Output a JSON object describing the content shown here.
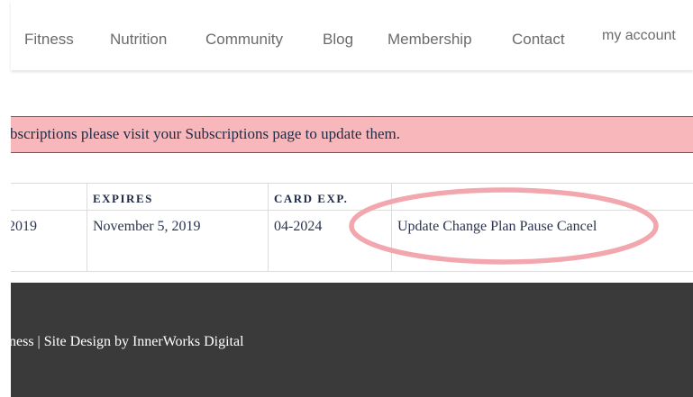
{
  "nav": {
    "items": [
      "Fitness",
      "Nutrition",
      "Community",
      "Blog",
      "Membership",
      "Contact"
    ],
    "account_label": "my account"
  },
  "notice": {
    "text": "bscriptions please visit your Subscriptions page to update them.",
    "background_color": "#f8b7bb",
    "border_color": "#c8323c"
  },
  "table": {
    "headers": [
      "EXPIRES",
      "CARD EXP."
    ],
    "row": {
      "start": "2019",
      "expires": "November 5, 2019",
      "card_exp": "04-2024",
      "actions": [
        "Update",
        "Change Plan",
        "Pause",
        "Cancel"
      ]
    }
  },
  "highlight": {
    "color": "#f2a6ad"
  },
  "footer": {
    "text": "ness | Site Design by InnerWorks Digital",
    "background_color": "#3a3a3a"
  }
}
